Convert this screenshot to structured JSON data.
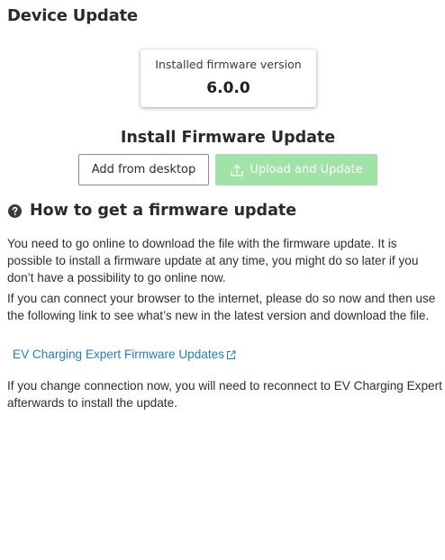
{
  "page": {
    "title": "Device Update"
  },
  "firmware_card": {
    "label": "Installed firmware version",
    "version": "6.0.0"
  },
  "install": {
    "title": "Install Firmware Update",
    "add_button_label": "Add from desktop",
    "upload_button_label": "Upload and Update",
    "upload_button_color": "#9fe3a6",
    "upload_icon": "upload-icon"
  },
  "howto": {
    "icon": "help-circle-icon",
    "heading": "How to get a firmware update",
    "paragraph1": "You need to go online to download the file with the firmware update. It is possible to install a firmware update at any time, you might do so later if you don’t have a possibility to go online now.",
    "paragraph2": "If you can connect your browser to the internet, please do so now and then use the following link to see what’s new in the latest version and download the file.",
    "link_label": "EV Charging Expert Firmware Updates",
    "link_icon": "external-link-icon",
    "link_color": "#1f7fc4",
    "paragraph3": "If you change connection now, you will need to reconnect to EV Charging Expert afterwards to install the update."
  }
}
